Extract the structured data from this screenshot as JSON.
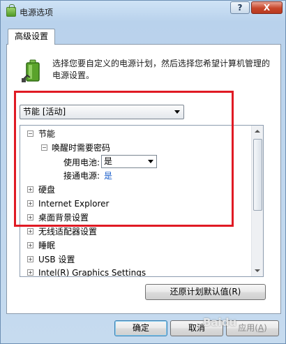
{
  "window": {
    "title": "电源选项",
    "help_label": "?",
    "close_label": "X"
  },
  "tab": {
    "label": "高级设置"
  },
  "description": "选择您要自定义的电源计划，然后选择您希望计算机管理的电源设置。",
  "plan_select": {
    "value": "节能 [活动]"
  },
  "tree": {
    "items": [
      {
        "label": "节能",
        "expander": "⊟"
      },
      {
        "label": "唤醒时需要密码",
        "expander": "⊟"
      },
      {
        "label": "使用电池:",
        "value": "是"
      },
      {
        "label": "接通电源:",
        "value": "是"
      },
      {
        "label": "硬盘",
        "expander": "⊞"
      },
      {
        "label": "Internet Explorer",
        "expander": "⊞"
      },
      {
        "label": "桌面背景设置",
        "expander": "⊞"
      },
      {
        "label": "无线适配器设置",
        "expander": "⊞"
      },
      {
        "label": "睡眠",
        "expander": "⊞"
      },
      {
        "label": "USB 设置",
        "expander": "⊞"
      },
      {
        "label": "Intel(R) Graphics Settings",
        "expander": "⊞"
      }
    ]
  },
  "buttons": {
    "restore": "还原计划默认值(R)",
    "ok": "确定",
    "cancel": "取消",
    "apply": "应用(",
    "apply_key": "A",
    "apply_end": ")"
  },
  "watermark": "Baidu",
  "colors": {
    "highlight_box": "#e01a24",
    "link_value": "#1a5ecb"
  }
}
